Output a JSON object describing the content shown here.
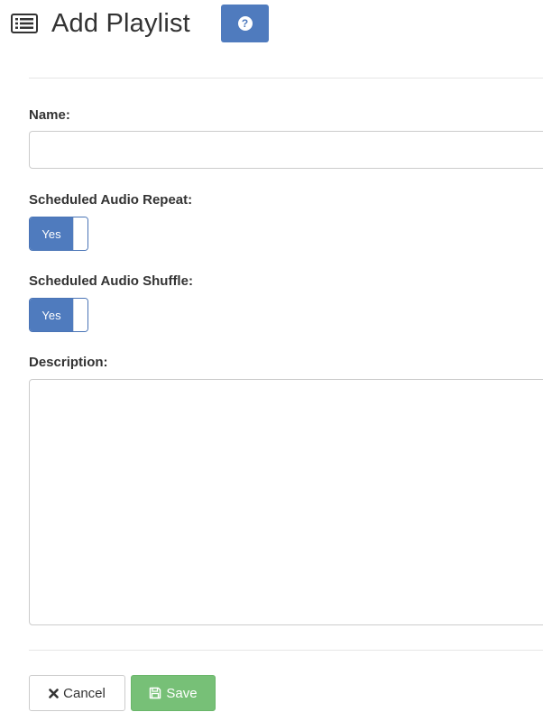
{
  "header": {
    "title": "Add Playlist",
    "title_icon": "list-icon",
    "help_icon": "question-circle-icon",
    "help_label": "?"
  },
  "form": {
    "name": {
      "label": "Name:",
      "value": "",
      "placeholder": ""
    },
    "repeat": {
      "label": "Scheduled Audio Repeat:",
      "state_label": "Yes"
    },
    "shuffle": {
      "label": "Scheduled Audio Shuffle:",
      "state_label": "Yes"
    },
    "description": {
      "label": "Description:",
      "value": "",
      "placeholder": ""
    }
  },
  "actions": {
    "cancel_label": "Cancel",
    "cancel_icon": "times-icon",
    "save_label": "Save",
    "save_icon": "floppy-disk-icon"
  },
  "colors": {
    "primary": "#4f7bbe",
    "success": "#77c077",
    "text": "#333333",
    "border": "#cccccc"
  }
}
